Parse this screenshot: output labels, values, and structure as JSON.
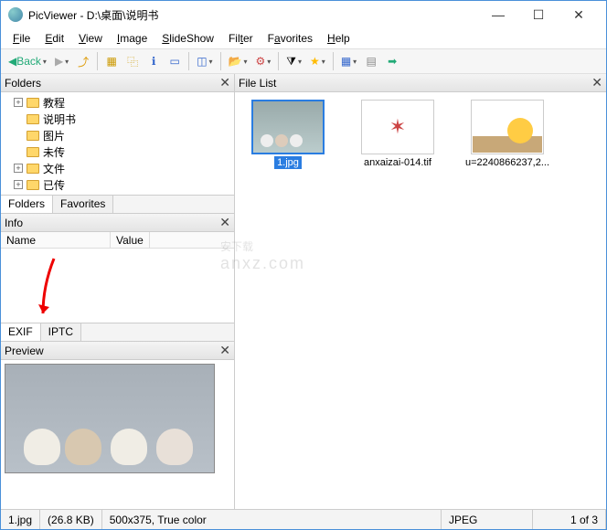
{
  "title": "PicViewer - D:\\桌面\\说明书",
  "window": {
    "minimize": "—",
    "maximize": "☐",
    "close": "✕"
  },
  "menu": {
    "file": "File",
    "edit": "Edit",
    "view": "View",
    "image": "Image",
    "slideshow": "SlideShow",
    "filter": "Filter",
    "favorites": "Favorites",
    "help": "Help"
  },
  "toolbar": {
    "back_label": "Back"
  },
  "panels": {
    "folders": {
      "title": "Folders",
      "items": [
        "教程",
        "说明书",
        "图片",
        "未传",
        "文件",
        "已传"
      ],
      "exp": [
        "+",
        "",
        "",
        "",
        "+",
        "+"
      ],
      "tabs": [
        "Folders",
        "Favorites"
      ]
    },
    "info": {
      "title": "Info",
      "cols": {
        "name": "Name",
        "value": "Value"
      },
      "tabs": [
        "EXIF",
        "IPTC"
      ]
    },
    "preview": {
      "title": "Preview"
    },
    "filelist": {
      "title": "File List",
      "items": [
        {
          "label": "1.jpg",
          "selected": true
        },
        {
          "label": "anxaizai-014.tif",
          "selected": false
        },
        {
          "label": "u=2240866237,2...",
          "selected": false
        }
      ]
    }
  },
  "status": {
    "filename": "1.jpg",
    "size": "(26.8 KB)",
    "dims": "500x375, True color",
    "type": "JPEG",
    "count": "1 of 3"
  },
  "watermark": {
    "main": "安下载",
    "sub": "anxz.com"
  }
}
